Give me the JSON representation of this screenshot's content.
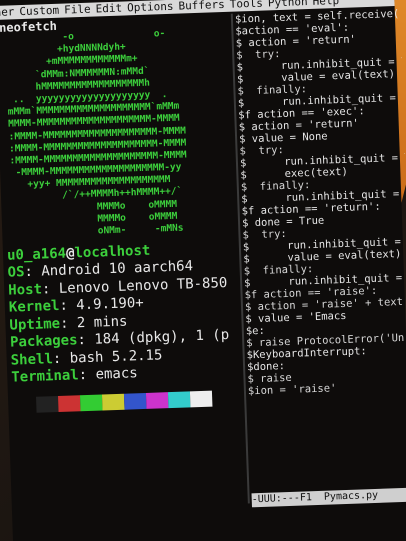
{
  "menubar": [
    "ner",
    "Custom",
    "File",
    "Edit",
    "Options",
    "Buffers",
    "Tools",
    "Python",
    "Help"
  ],
  "left": {
    "title": "neofetch",
    "ascii": [
      "           -o              o-",
      "          +hydNNNNdyh+",
      "        +mMMMMMMMMMMMMm+",
      "      `dMMm:NMMMMMMN:mMMd`",
      "      hMMMMMMMMMMMMMMMMMMh",
      "  ..  yyyyyyyyyyyyyyyyyyyy  .",
      " mMMm`MMMMMMMMMMMMMMMMMMMM`mMMm",
      " MMMM-MMMMMMMMMMMMMMMMMMMM-MMMM",
      " :MMMM-MMMMMMMMMMMMMMMMMMMM-MMMM",
      " :MMMM-MMMMMMMMMMMMMMMMMMMM-MMMM",
      " :MMMM-MMMMMMMMMMMMMMMMMMMM-MMMM",
      "  -MMMM-MMMMMMMMMMMMMMMMMMMM-yy",
      "    +yy+ MMMMMMMMMMMMMMMMMMMM",
      "          /`/++MMMMh++hMMMM++/`",
      "                MMMMo    oMMMM",
      "                MMMMo    oMMMM",
      "                oNMm-     -mMNs"
    ],
    "user": "u0_a164",
    "at": "@",
    "host": "localhost",
    "info": [
      {
        "key": "OS",
        "value": "Android 10 aarch64"
      },
      {
        "key": "Host",
        "value": "Lenovo Lenovo TB-850"
      },
      {
        "key": "Kernel",
        "value": "4.9.190+"
      },
      {
        "key": "Uptime",
        "value": "2 mins"
      },
      {
        "key": "Packages",
        "value": "184 (dpkg), 1 (p"
      },
      {
        "key": "Shell",
        "value": "bash 5.2.15"
      },
      {
        "key": "Terminal",
        "value": "emacs"
      }
    ],
    "palette": [
      "#222222",
      "#cc3333",
      "#33cc33",
      "#cccc33",
      "#3355cc",
      "#cc33cc",
      "#33cccc",
      "#eeeeee"
    ]
  },
  "right": {
    "lines": [
      "$ion, text = self.receive()",
      "$action == 'eval':",
      "$ action = 'return'",
      "$  try:",
      "$      run.inhibit_quit = T",
      "$      value = eval(text)",
      "$  finally:",
      "$      run.inhibit_quit = F",
      "$f action == 'exec':",
      "$ action = 'return'",
      "$ value = None",
      "$  try:",
      "$      run.inhibit_quit = T",
      "$      exec(text)",
      "$  finally:",
      "$      run.inhibit_quit = F",
      "$f action == 'return':",
      "$ done = True",
      "$  try:",
      "$      run.inhibit_quit = T",
      "$      value = eval(text)",
      "$  finally:",
      "$      run.inhibit_quit = F",
      "$f action == 'raise':",
      "$ action = 'raise' + text",
      "$ value = 'Emacs",
      "$e:",
      "$ raise ProtocolError('Un",
      "$KeyboardInterrupt:",
      "$done:",
      "$ raise",
      "$ion = 'raise'"
    ],
    "modeline": "-UUU:---F1  Pymacs.py"
  }
}
